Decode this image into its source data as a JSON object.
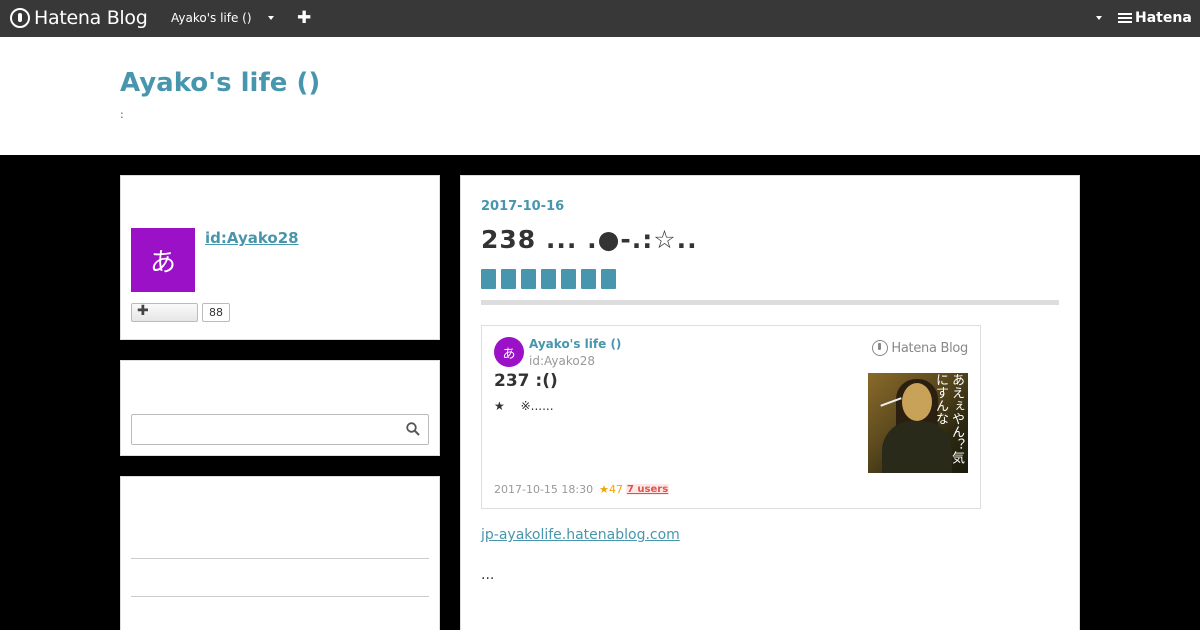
{
  "globalbar": {
    "logo_text": "Hatena Blog",
    "blog_name": "Ayako's life ()",
    "hatena_text": "Hatena"
  },
  "header": {
    "title": "Ayako's life ()",
    "description": ":"
  },
  "sidebar": {
    "profile": {
      "avatar_char": "あ",
      "user_id": "id:Ayako28",
      "follow_count": "88"
    },
    "search": {
      "placeholder": ""
    }
  },
  "article": {
    "date": "2017-10-16",
    "title": "238 ...     .●-.:☆..",
    "tag_count": 7,
    "embed": {
      "avatar_char": "あ",
      "blog_name": "Ayako's life ()",
      "user_id": "id:Ayako28",
      "brand": "Hatena Blog",
      "title": "237 :()",
      "description": "★　 ※......",
      "thumb_text": "あえぇやん？気にすんな",
      "timestamp": "2017-10-15 18:30",
      "stars": "★47",
      "users": "7 users"
    },
    "link": "jp-ayakolife.hatenablog.com",
    "body": "..."
  }
}
